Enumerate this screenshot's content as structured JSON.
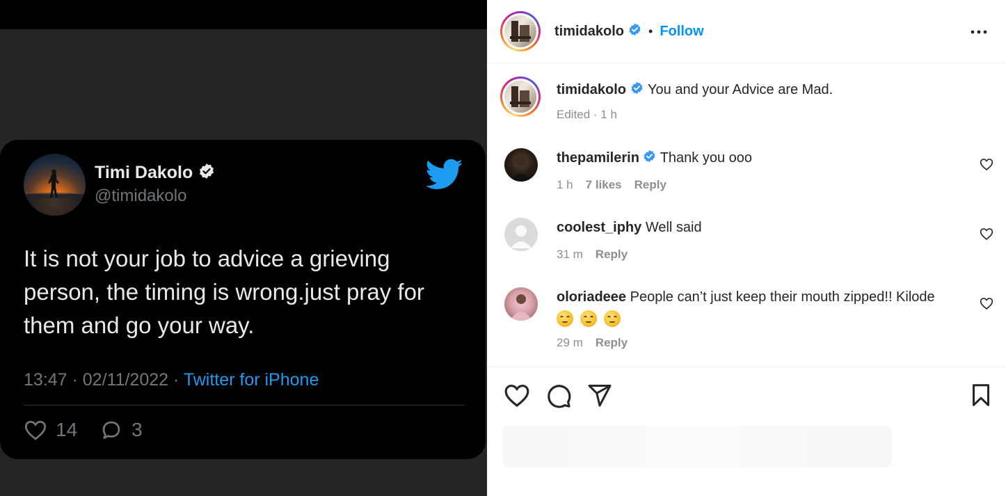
{
  "tweet": {
    "name": "Timi Dakolo",
    "handle": "@timidakolo",
    "text": "It is not your job to advice a grieving person, the timing is wrong.just pray for them and go your way.",
    "time": "13:47 · 02/11/2022 · ",
    "source": "Twitter for iPhone",
    "likes": "14",
    "replies": "3",
    "avatar_icon": "sunset-avatar",
    "logo_icon": "twitter-bird-icon",
    "accent_color": "#1d9bf0"
  },
  "post": {
    "username": "timidakolo",
    "dot": "•",
    "follow_label": "Follow",
    "more_icon": "more-options-icon",
    "caption": "You and your Advice are Mad.",
    "caption_meta": "Edited · 1 h",
    "verified_color": "#3897f0",
    "follow_color": "#0095f6"
  },
  "comments": [
    {
      "username": "thepamilerin",
      "verified": true,
      "text": "Thank you ooo",
      "time": "1 h",
      "likes": "7 likes",
      "reply": "Reply"
    },
    {
      "username": "coolest_iphy",
      "verified": false,
      "text": "Well said",
      "time": "31 m",
      "reply": "Reply"
    },
    {
      "username": "oloriadeee",
      "verified": false,
      "text": "People can’t just keep their mouth zipped!! Kilode",
      "emojis": [
        "relieved-face",
        "relieved-face",
        "relieved-face"
      ],
      "time": "29 m",
      "reply": "Reply"
    }
  ],
  "action_icons": [
    "heart-icon",
    "comment-icon",
    "share-icon",
    "bookmark-icon"
  ]
}
